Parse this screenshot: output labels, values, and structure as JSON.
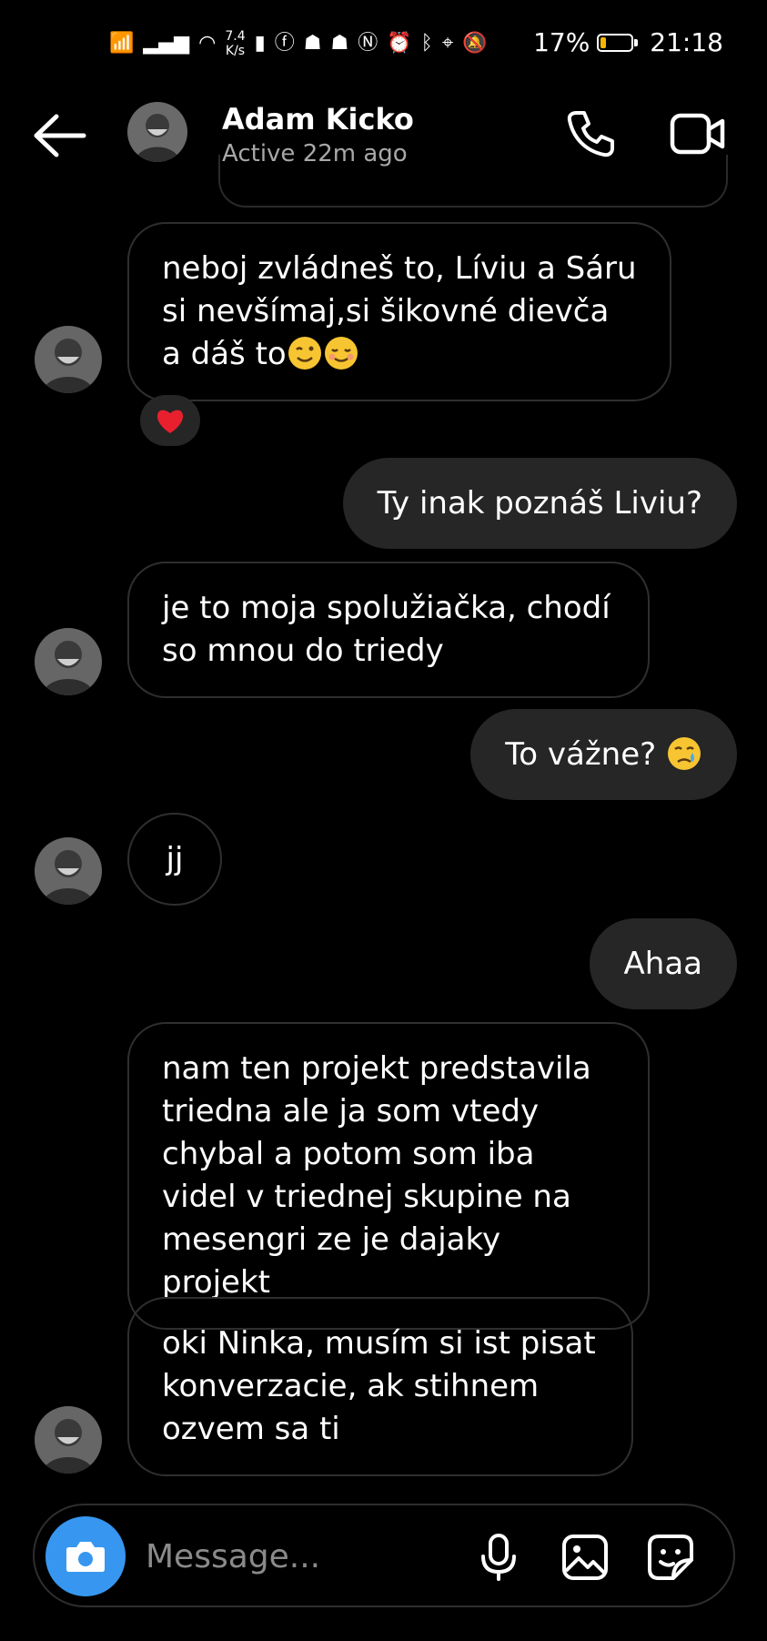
{
  "status_bar": {
    "net_speed": "7.4\nK/s",
    "battery_text": "17%",
    "battery_level": 0.17,
    "time": "21:18",
    "icons": [
      "wifi-calling-icon",
      "signal-icon",
      "wifi-icon",
      "battery-saver-icon",
      "facebook-icon",
      "snapchat-icon",
      "snapchat-icon",
      "nfc-icon",
      "alarm-icon",
      "bluetooth-icon",
      "location-icon",
      "mute-icon"
    ]
  },
  "header": {
    "name": "Adam Kicko",
    "status": "Active 22m ago"
  },
  "messages": [
    {
      "dir": "in",
      "text": "neboj zvládneš to, Líviu a Sáru si nevšímaj,si šikovné dievča a dáš to",
      "emoji": [
        "winking-face",
        "smiling-face"
      ],
      "reaction": "red-heart"
    },
    {
      "dir": "out",
      "text": "Ty inak poznáš Liviu?"
    },
    {
      "dir": "in",
      "text": "je to moja spolužiačka, chodí so mnou do triedy"
    },
    {
      "dir": "out",
      "text": "To vážne?",
      "emoji": [
        "crying-face"
      ]
    },
    {
      "dir": "in",
      "text": "jj"
    },
    {
      "dir": "out",
      "text": "Ahaa"
    },
    {
      "dir": "in",
      "text": "nam ten projekt predstavila triedna ale ja som vtedy chybal a potom som iba videl v triednej skupine na mesengri ze je dajaky projekt"
    },
    {
      "dir": "in",
      "text": "oki Ninka, musím si ist pisat konverzacie, ak stihnem ozvem sa ti"
    }
  ],
  "composer": {
    "placeholder": "Message..."
  },
  "colors": {
    "background": "#000000",
    "incoming_border": "#2f2f2f",
    "outgoing_bg": "#262626",
    "camera_button": "#3797f0",
    "secondary_text": "#a8a8a8"
  }
}
